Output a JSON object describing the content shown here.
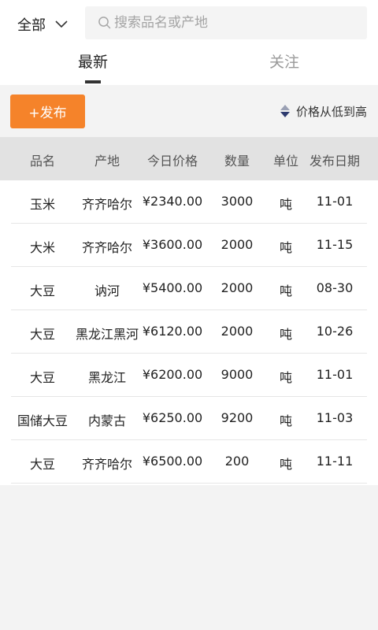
{
  "header": {
    "filter_label": "全部",
    "search_placeholder": "搜索品名或产地",
    "tabs": [
      {
        "label": "最新",
        "active": true
      },
      {
        "label": "关注",
        "active": false
      }
    ]
  },
  "actions": {
    "publish_label": "+发布",
    "sort_label": "价格从低到高"
  },
  "table": {
    "columns": [
      "品名",
      "产地",
      "今日价格",
      "数量",
      "单位",
      "发布日期"
    ],
    "rows": [
      [
        "玉米",
        "齐齐哈尔",
        "¥2340.00",
        "3000",
        "吨",
        "11-01"
      ],
      [
        "大米",
        "齐齐哈尔",
        "¥3600.00",
        "2000",
        "吨",
        "11-15"
      ],
      [
        "大豆",
        "讷河",
        "¥5400.00",
        "2000",
        "吨",
        "08-30"
      ],
      [
        "大豆",
        "黑龙江黑河",
        "¥6120.00",
        "2000",
        "吨",
        "10-26"
      ],
      [
        "大豆",
        "黑龙江",
        "¥6200.00",
        "9000",
        "吨",
        "11-01"
      ],
      [
        "国储大豆",
        "内蒙古",
        "¥6250.00",
        "9200",
        "吨",
        "11-03"
      ],
      [
        "大豆",
        "齐齐哈尔",
        "¥6500.00",
        "200",
        "吨",
        "11-11"
      ]
    ]
  },
  "colors": {
    "accent": "#f5832a",
    "header_bg": "#e2e2e2",
    "page_bg": "#f3f3f3",
    "sort_up": "#9aa0b4",
    "sort_down": "#2d3a6e"
  },
  "icons": {
    "filter": "chevron-down-icon",
    "search": "search-icon",
    "sort": "sort-icon"
  }
}
